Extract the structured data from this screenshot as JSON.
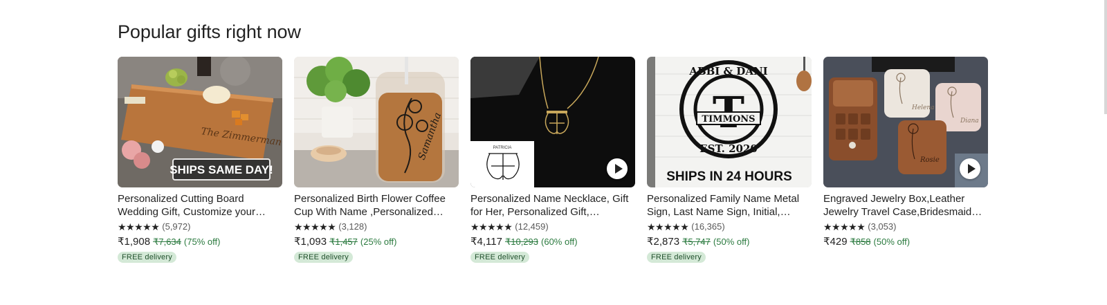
{
  "section": {
    "title": "Popular gifts right now"
  },
  "products": [
    {
      "title": "Personalized Cutting Board Wedding Gift, Customize your Cutting Board",
      "stars": "★★★★★",
      "reviews": "(5,972)",
      "price": "₹1,908",
      "original_price": "₹7,634",
      "discount": "(75% off)",
      "badge": "FREE delivery",
      "image_text": "SHIPS SAME DAY!",
      "engraving": "The Zimmerman's",
      "has_video": false
    },
    {
      "title": "Personalized Birth Flower Coffee Cup With Name ,Personalized Glass Cup",
      "stars": "★★★★★",
      "reviews": "(3,128)",
      "price": "₹1,093",
      "original_price": "₹1,457",
      "discount": "(25% off)",
      "badge": "FREE delivery",
      "engraving": "Samantha",
      "has_video": false
    },
    {
      "title": "Personalized Name Necklace, Gift for Her, Personalized Gift, Monogram",
      "stars": "★★★★★",
      "reviews": "(12,459)",
      "price": "₹4,117",
      "original_price": "₹10,293",
      "discount": "(60% off)",
      "badge": "FREE delivery",
      "inset_label": "PATRICIA",
      "has_video": true
    },
    {
      "title": "Personalized Family Name Metal Sign, Last Name Sign, Initial, Wedding Gift",
      "stars": "★★★★★",
      "reviews": "(16,365)",
      "price": "₹2,873",
      "original_price": "₹5,747",
      "discount": "(50% off)",
      "badge": "FREE delivery",
      "sign_top": "ABBI & DANI",
      "sign_letter": "T",
      "sign_name": "TIMMONS",
      "sign_est": "EST. 2020",
      "image_text": "SHIPS IN 24 HOURS",
      "has_video": false
    },
    {
      "title": "Engraved Jewelry Box,Leather Jewelry Travel Case,Bridesmaid Gift",
      "stars": "★★★★★",
      "reviews": "(3,053)",
      "price": "₹429",
      "original_price": "₹858",
      "discount": "(50% off)",
      "badge": "",
      "box_names": [
        "Helena",
        "Diana",
        "Rosie"
      ],
      "has_video": true
    }
  ],
  "colors": {
    "sale_green": "#2b7a3f",
    "badge_bg": "#d4e9d7",
    "text": "#222222"
  }
}
